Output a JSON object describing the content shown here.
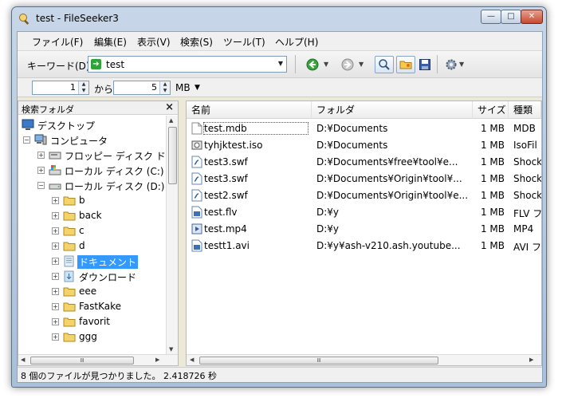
{
  "window": {
    "title": "test - FileSeeker3"
  },
  "menu": [
    "ファイル(F)",
    "編集(E)",
    "表示(V)",
    "検索(S)",
    "ツール(T)",
    "ヘルプ(H)"
  ],
  "toolbar": {
    "keyword_label": "キーワード(D)",
    "keyword_value": "test",
    "icons": [
      "back-icon",
      "forward-icon",
      "search-toggle-icon",
      "folder-open-icon",
      "save-icon",
      "settings-gear-icon"
    ]
  },
  "range": {
    "min": "1",
    "separator": "から",
    "max": "5",
    "unit": "MB"
  },
  "tree": {
    "title": "検索フォルダ",
    "close": "×",
    "nodes": [
      {
        "label": "デスクトップ",
        "icon": "desktop-icon"
      },
      {
        "label": "コンピュータ",
        "icon": "computer-icon"
      },
      {
        "label": "フロッピー ディスク ドラ",
        "icon": "floppy-icon"
      },
      {
        "label": "ローカル ディスク (C:)",
        "icon": "drive-icon"
      },
      {
        "label": "ローカル ディスク (D:)",
        "icon": "drive-icon"
      },
      {
        "label": "b",
        "icon": "folder-icon"
      },
      {
        "label": "back",
        "icon": "folder-icon"
      },
      {
        "label": "c",
        "icon": "folder-icon"
      },
      {
        "label": "d",
        "icon": "folder-icon"
      },
      {
        "label": "ドキュメント",
        "icon": "folder-icon",
        "selected": true
      },
      {
        "label": "ダウンロード",
        "icon": "folder-icon"
      },
      {
        "label": "eee",
        "icon": "folder-icon"
      },
      {
        "label": "FastKake",
        "icon": "folder-icon"
      },
      {
        "label": "favorit",
        "icon": "folder-icon"
      },
      {
        "label": "ggg",
        "icon": "folder-icon"
      }
    ]
  },
  "list": {
    "columns": [
      "名前",
      "フォルダ",
      "サイズ",
      "種類"
    ],
    "rows": [
      {
        "name": "test.mdb",
        "folder": "D:¥Documents",
        "size": "1 MB",
        "type": "MDB",
        "icon": "mdb-file-icon"
      },
      {
        "name": "tyhjktest.iso",
        "folder": "D:¥Documents",
        "size": "1 MB",
        "type": "IsoFil",
        "icon": "iso-file-icon"
      },
      {
        "name": "test3.swf",
        "folder": "D:¥Documents¥free¥tool¥e...",
        "size": "1 MB",
        "type": "Shock",
        "icon": "swf-file-icon"
      },
      {
        "name": "test3.swf",
        "folder": "D:¥Documents¥Origin¥tool¥...",
        "size": "1 MB",
        "type": "Shock",
        "icon": "swf-file-icon"
      },
      {
        "name": "test2.swf",
        "folder": "D:¥Documents¥Origin¥tool¥e...",
        "size": "1 MB",
        "type": "Shock",
        "icon": "swf-file-icon"
      },
      {
        "name": "test.flv",
        "folder": "D:¥y",
        "size": "1 MB",
        "type": "FLV フ",
        "icon": "flv-file-icon"
      },
      {
        "name": "test.mp4",
        "folder": "D:¥y",
        "size": "1 MB",
        "type": "MP4",
        "icon": "mp4-file-icon"
      },
      {
        "name": "testt1.avi",
        "folder": "D:¥y¥ash-v210.ash.youtube...",
        "size": "1 MB",
        "type": "AVI フ",
        "icon": "avi-file-icon"
      }
    ]
  },
  "status": {
    "text": "8 個のファイルが見つかりました。 2.418726 秒"
  },
  "colors": {
    "selection": "#3399ff",
    "title_bar": "#b7cbe3",
    "link_green": "#2fa33a"
  }
}
